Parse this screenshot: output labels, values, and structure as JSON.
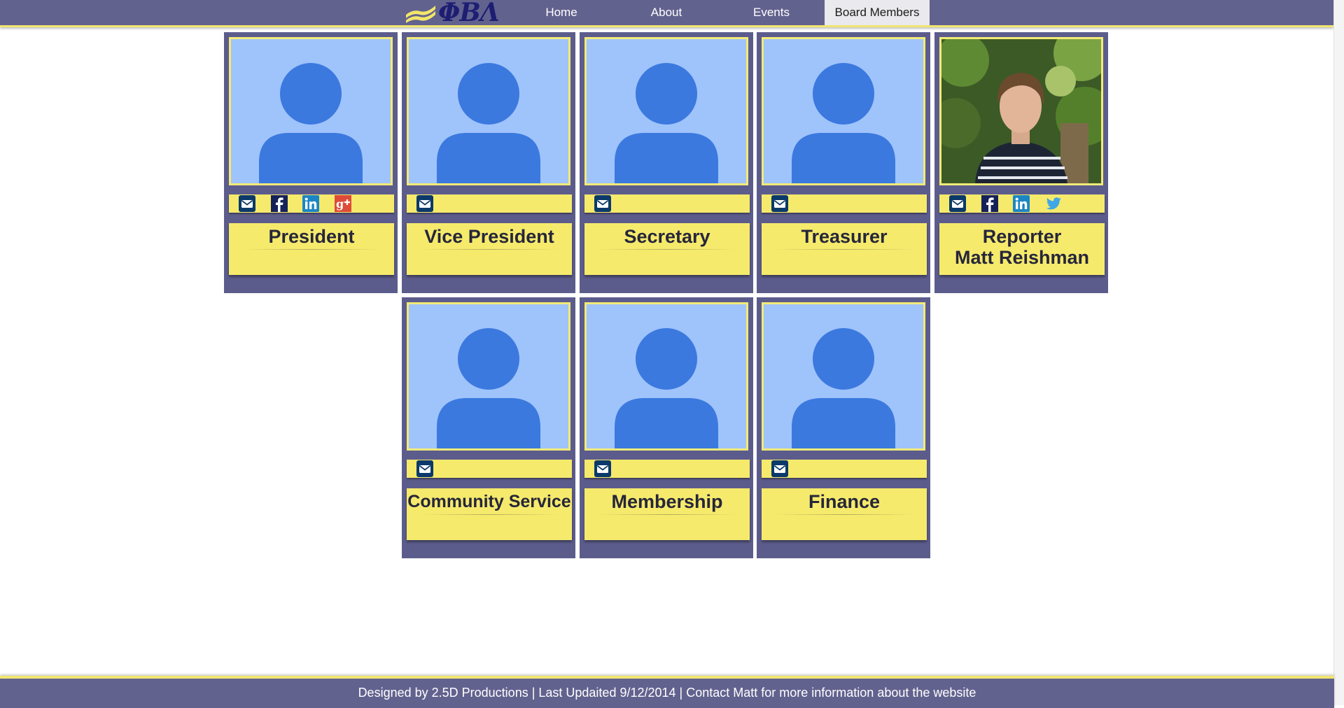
{
  "brand": {
    "logo_text": "ΦΒΛ"
  },
  "nav": {
    "items": [
      {
        "label": "Home"
      },
      {
        "label": "About"
      },
      {
        "label": "Events"
      },
      {
        "label": "Board Members",
        "active": true
      }
    ]
  },
  "colors": {
    "bar": "#62628f",
    "accent_yellow": "#f6ea6c",
    "placeholder_bg": "#9fc3fb",
    "placeholder_figure": "#3b79df"
  },
  "board": [
    {
      "role": "President",
      "name": "",
      "photo": "placeholder",
      "icons": [
        "mail-icon",
        "facebook-icon",
        "linkedin-icon",
        "google-plus-icon"
      ]
    },
    {
      "role": "Vice President",
      "name": "",
      "photo": "placeholder",
      "icons": [
        "mail-icon"
      ]
    },
    {
      "role": "Secretary",
      "name": "",
      "photo": "placeholder",
      "icons": [
        "mail-icon"
      ]
    },
    {
      "role": "Treasurer",
      "name": "",
      "photo": "placeholder",
      "icons": [
        "mail-icon"
      ]
    },
    {
      "role": "Reporter",
      "name": "Matt Reishman",
      "photo": "portrait",
      "icons": [
        "mail-icon",
        "facebook-icon",
        "linkedin-icon",
        "twitter-icon"
      ]
    },
    {
      "role": "Community Service",
      "name": "",
      "photo": "placeholder",
      "icons": [
        "mail-icon"
      ]
    },
    {
      "role": "Membership",
      "name": "",
      "photo": "placeholder",
      "icons": [
        "mail-icon"
      ]
    },
    {
      "role": "Finance",
      "name": "",
      "photo": "placeholder",
      "icons": [
        "mail-icon"
      ]
    }
  ],
  "footer": {
    "text": "Designed by 2.5D Productions | Last Updaited 9/12/2014 | Contact Matt for more information about the website"
  }
}
